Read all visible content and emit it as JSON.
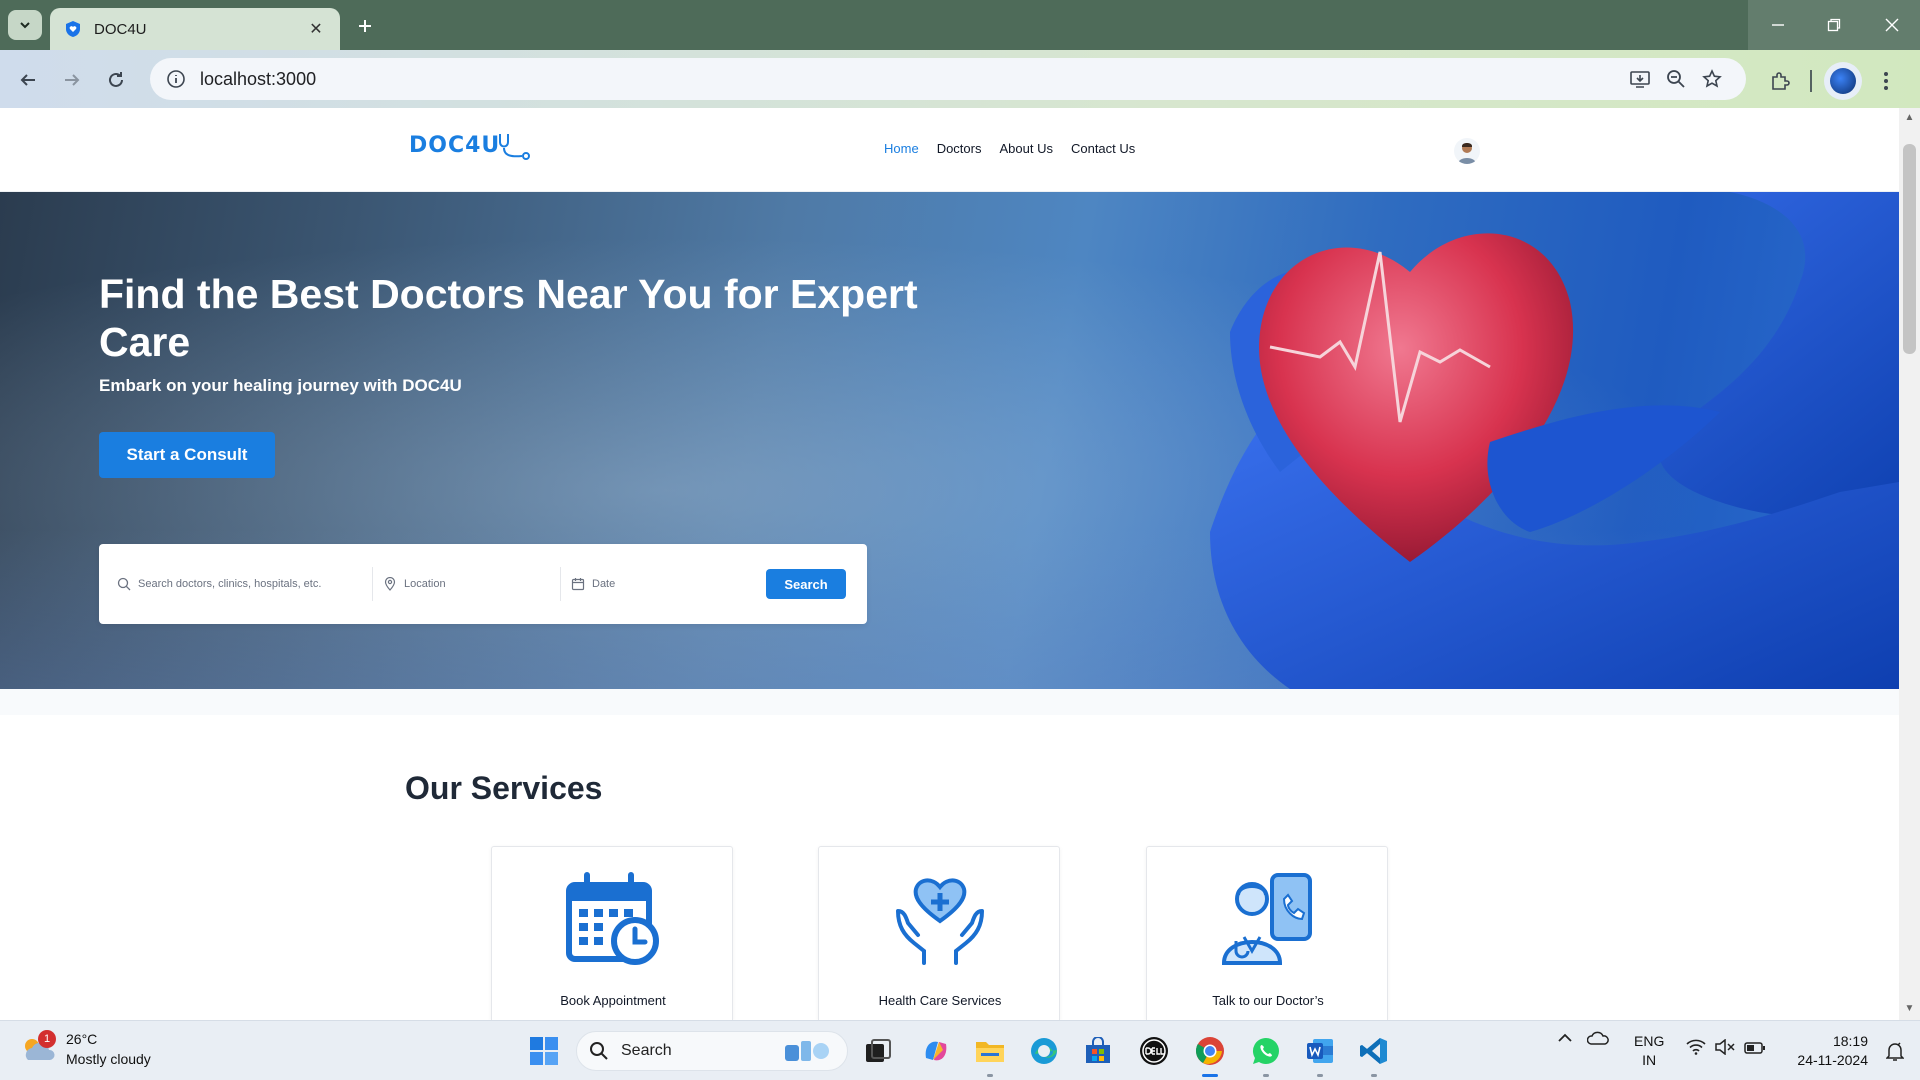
{
  "browser": {
    "tab_title": "DOC4U",
    "url": "localhost:3000"
  },
  "site": {
    "logo": "DOC4U",
    "nav": [
      "Home",
      "Doctors",
      "About Us",
      "Contact Us"
    ],
    "active_nav": "Home",
    "accent_color": "#1a7ee0"
  },
  "hero": {
    "title": "Find the Best Doctors Near You for Expert Care",
    "subtitle": "Embark on your healing journey with DOC4U",
    "cta_label": "Start a Consult",
    "search": {
      "query_placeholder": "Search doctors, clinics, hospitals, etc.",
      "location_placeholder": "Location",
      "date_placeholder": "Date",
      "button_label": "Search"
    }
  },
  "services": {
    "heading": "Our Services",
    "items": [
      {
        "label": "Book Appointment",
        "icon": "calendar-clock-icon"
      },
      {
        "label": "Health Care Services",
        "icon": "heart-hands-icon"
      },
      {
        "label": "Talk to our Doctor’s",
        "icon": "doctor-phone-icon"
      }
    ]
  },
  "taskbar": {
    "weather_temp": "26°C",
    "weather_desc": "Mostly cloudy",
    "weather_badge": "1",
    "search_label": "Search",
    "lang_line1": "ENG",
    "lang_line2": "IN",
    "time": "18:19",
    "date": "24-11-2024"
  }
}
